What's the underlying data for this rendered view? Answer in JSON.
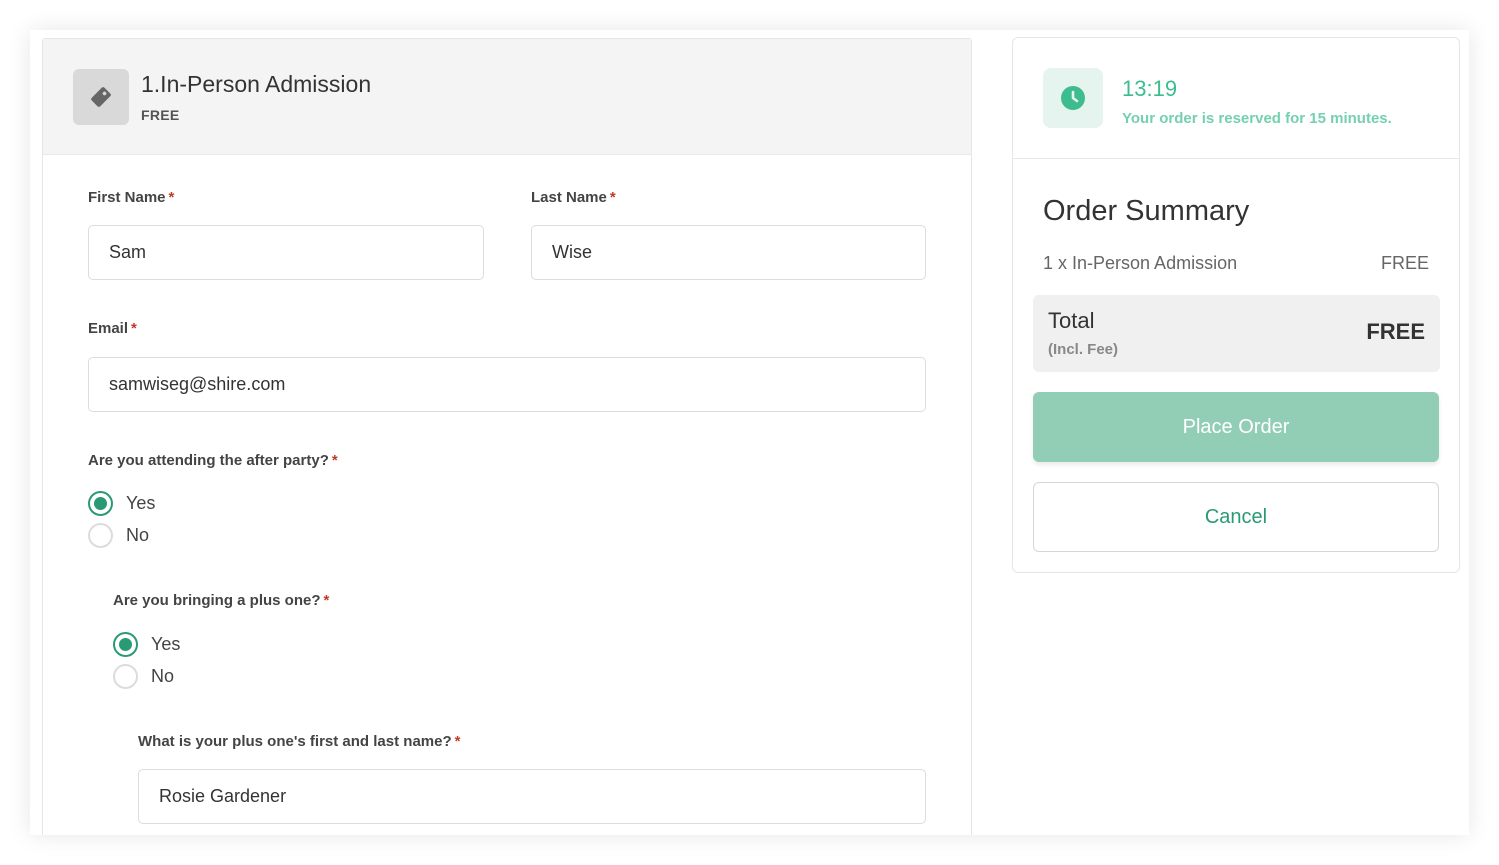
{
  "ticket": {
    "title": "1.In-Person Admission",
    "price": "FREE"
  },
  "form": {
    "first_name": {
      "label": "First Name",
      "value": "Sam"
    },
    "last_name": {
      "label": "Last Name",
      "value": "Wise"
    },
    "email": {
      "label": "Email",
      "value": "samwiseg@shire.com"
    },
    "required_marker": "*",
    "after_party": {
      "question": "Are you attending the after party?",
      "options": [
        "Yes",
        "No"
      ],
      "selected": "Yes"
    },
    "plus_one": {
      "question": "Are you bringing a plus one?",
      "options": [
        "Yes",
        "No"
      ],
      "selected": "Yes"
    },
    "plus_one_name": {
      "label": "What is your plus one's first and last name?",
      "value": "Rosie Gardener"
    }
  },
  "timer": {
    "time": "13:19",
    "note": "Your order is reserved for 15 minutes.",
    "icon": "clock-icon"
  },
  "summary": {
    "title": "Order Summary",
    "items": [
      {
        "label": "1 x In-Person Admission",
        "price": "FREE"
      }
    ],
    "total_label": "Total",
    "total_sub": "(Incl. Fee)",
    "total_value": "FREE",
    "place_order": "Place Order",
    "cancel": "Cancel"
  },
  "colors": {
    "accent": "#2a9a74",
    "timer": "#3dbd8f",
    "place_order_bg": "#92cdb6"
  }
}
